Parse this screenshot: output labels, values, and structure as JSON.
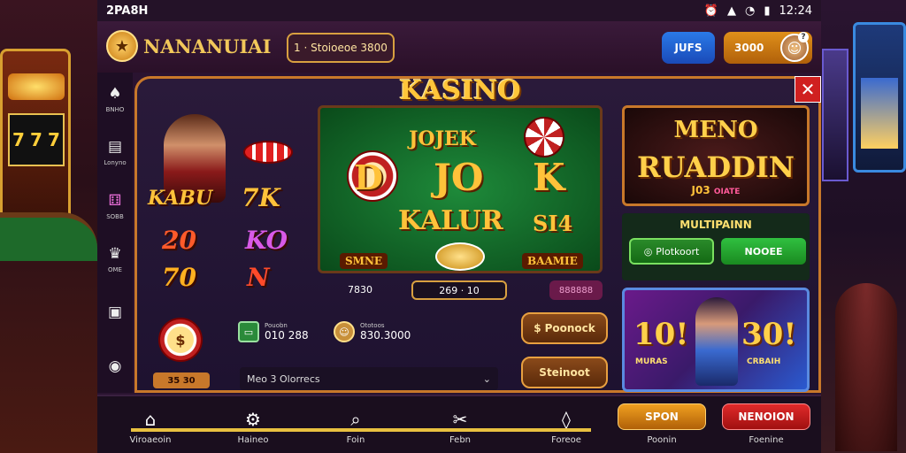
{
  "statusbar": {
    "time_left": "2PA8H",
    "time_right": "12:24",
    "icons": [
      "alarm-icon",
      "signal-icon",
      "wifi-icon",
      "battery-icon"
    ]
  },
  "header": {
    "logo_text": "NANANUIAI",
    "balance": "1 · Stoioeoe 3800",
    "login_label": "JUFS",
    "register_label": "3000"
  },
  "sidenav": {
    "items": [
      {
        "icon": "spade-icon",
        "label": "BNHO"
      },
      {
        "icon": "slot-icon",
        "label": "Lonyno"
      },
      {
        "icon": "dice-icon",
        "label": "SOBB"
      },
      {
        "icon": "cup-icon",
        "label": "OME"
      },
      {
        "icon": "card-icon",
        "label": ""
      },
      {
        "icon": "chips-icon",
        "label": ""
      }
    ]
  },
  "main": {
    "title": "KASINO",
    "close_symbol": "✕",
    "tiles": {
      "kabu": "KABU",
      "t7k": "7K",
      "t20": "20",
      "tko": "KO",
      "t70": "70",
      "tn": "N"
    },
    "table": {
      "jojek": "JOJEK",
      "d": "D",
      "jo": "JO",
      "k": "K",
      "kalur": "KALUR",
      "s14": "SI4",
      "smne": "SMNE",
      "baamie": "BAAMIE",
      "left_value": "7830",
      "score": "269 · 10",
      "right_pill": "888888"
    },
    "promo1": {
      "line1": "MENO",
      "line2": "RUADDIN",
      "sub": "J03",
      "sub2": "OIATE"
    },
    "multi": {
      "label": "MULTIPAINN",
      "btn_a": "Plotkoort",
      "btn_b": "NOOEE"
    },
    "promo2": {
      "left_big": "10!",
      "right_big": "30!",
      "left_sub": "MURAS",
      "right_sub": "CRBAIH"
    },
    "info": {
      "chip_counter": "35 30",
      "stat1_label": "Pouobn",
      "stat1_value": "010 288",
      "stat2_label": "Ototoos",
      "stat2_value": "830.3000",
      "select_prefix": "Meo",
      "select_value": "3 Olorrecs",
      "btn_gold_1": "Poonock",
      "btn_gold_2": "Steinoot"
    }
  },
  "bottom_nav": {
    "items": [
      {
        "icon": "home-icon",
        "label": "Viroaeoin"
      },
      {
        "icon": "gear-icon",
        "label": "Haineo"
      },
      {
        "icon": "search-icon",
        "label": "Foin"
      },
      {
        "icon": "tools-icon",
        "label": "Febn"
      },
      {
        "icon": "location-icon",
        "label": "Foreoe"
      }
    ],
    "btn_gold": "SPON",
    "btn_gold_label": "Poonin",
    "btn_red": "NENOION",
    "btn_red_label": "Foenine"
  }
}
